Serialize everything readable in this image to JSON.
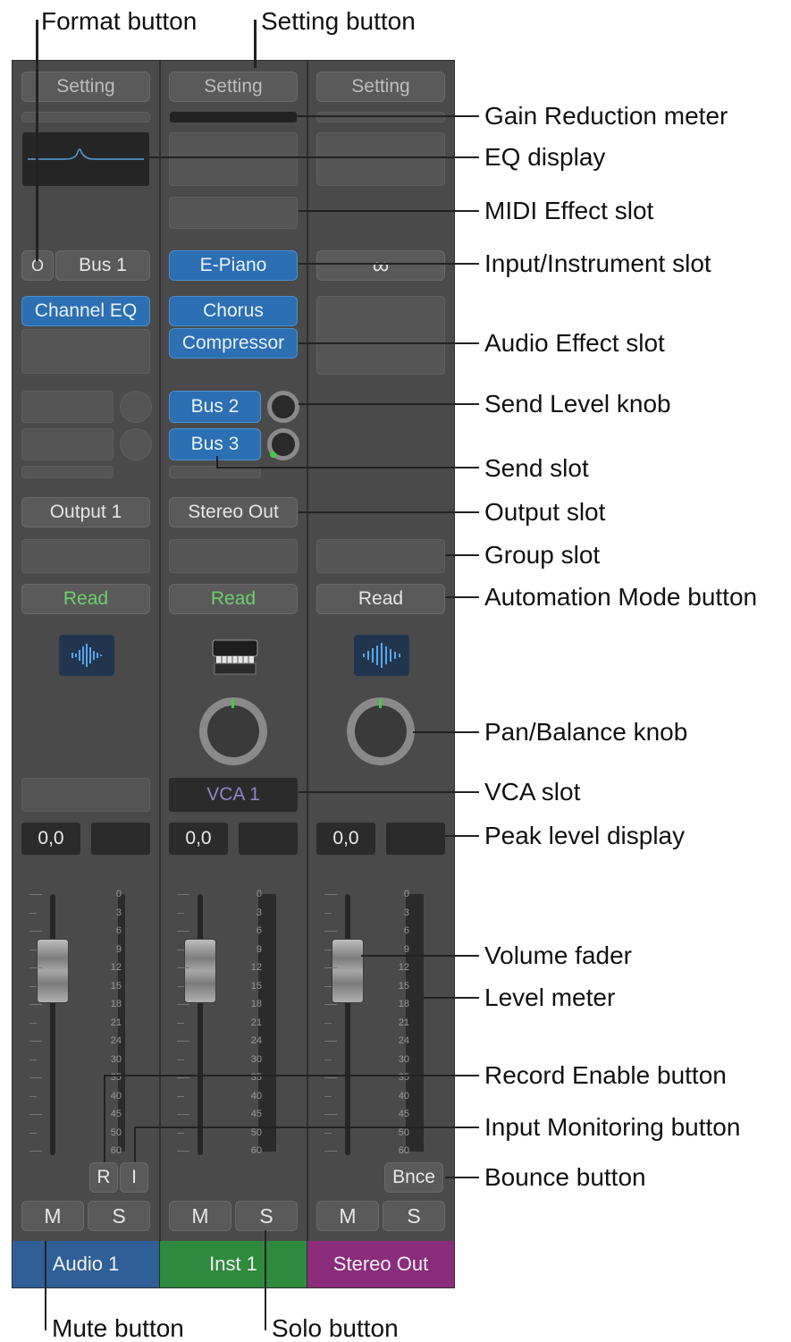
{
  "callouts": {
    "format_button": "Format button",
    "setting_button": "Setting button",
    "gain_reduction_meter": "Gain Reduction meter",
    "eq_display": "EQ display",
    "midi_effect_slot": "MIDI Effect slot",
    "input_instrument_slot": "Input/Instrument slot",
    "audio_effect_slot": "Audio Effect slot",
    "send_level_knob": "Send Level knob",
    "send_slot": "Send slot",
    "output_slot": "Output slot",
    "group_slot": "Group slot",
    "automation_mode_button": "Automation Mode button",
    "pan_balance_knob": "Pan/Balance knob",
    "vca_slot": "VCA slot",
    "peak_level_display": "Peak level display",
    "volume_fader": "Volume fader",
    "level_meter": "Level meter",
    "record_enable_button": "Record Enable button",
    "input_monitoring_button": "Input Monitoring button",
    "bounce_button": "Bounce button",
    "mute_button": "Mute button",
    "solo_button": "Solo button"
  },
  "strips": [
    {
      "setting": "Setting",
      "format": "O",
      "input": "Bus 1",
      "effects": [
        "Channel EQ"
      ],
      "output": "Output 1",
      "automation": "Read",
      "peak": "0,0",
      "record": "R",
      "monitor": "I",
      "mute": "M",
      "solo": "S",
      "name": "Audio 1",
      "color": "#2f5f96"
    },
    {
      "setting": "Setting",
      "input": "E-Piano",
      "effects": [
        "Chorus",
        "Compressor"
      ],
      "sends": [
        "Bus 2",
        "Bus 3"
      ],
      "output": "Stereo Out",
      "automation": "Read",
      "vca": "VCA 1",
      "peak": "0,0",
      "mute": "M",
      "solo": "S",
      "name": "Inst 1",
      "color": "#2e8a3c"
    },
    {
      "setting": "Setting",
      "input": "∞",
      "automation": "Read",
      "peak": "0,0",
      "bounce": "Bnce",
      "mute": "M",
      "solo": "S",
      "name": "Stereo Out",
      "color": "#8a2b7c"
    }
  ],
  "meter_scale": [
    "0",
    "3",
    "6",
    "9",
    "12",
    "15",
    "18",
    "21",
    "24",
    "30",
    "35",
    "40",
    "45",
    "50",
    "60"
  ]
}
